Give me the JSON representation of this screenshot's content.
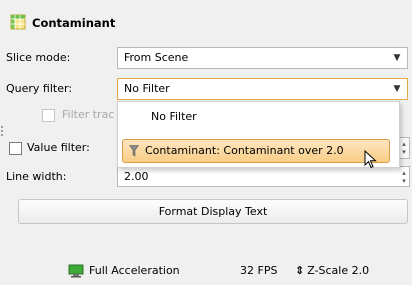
{
  "panel": {
    "title": "Contaminant",
    "icon": "table-icon"
  },
  "slice_mode": {
    "label": "Slice mode:",
    "value": "From Scene"
  },
  "query_filter": {
    "label": "Query filter:",
    "value": "No Filter",
    "options": [
      "No Filter",
      "Contaminant: Contaminant over 2.0"
    ],
    "highlighted": "Contaminant: Contaminant over 2.0"
  },
  "filter_trace": {
    "label": "Filter trac"
  },
  "value_filter": {
    "label": "Value filter:"
  },
  "line_width": {
    "label": "Line width:",
    "value": "2.00"
  },
  "format_button": {
    "label": "Format Display Text"
  },
  "status_bar": {
    "acceleration": "Full Acceleration",
    "fps": "32 FPS",
    "zscale": "Z-Scale 2.0"
  },
  "colors": {
    "accent": "#e09a45",
    "highlight": "#f9cd86"
  }
}
